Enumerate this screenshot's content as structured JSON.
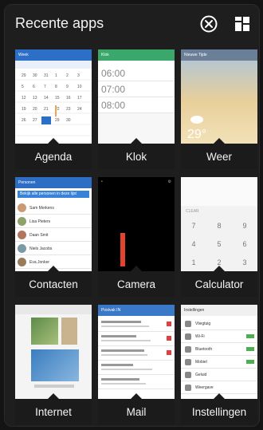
{
  "header": {
    "title": "Recente apps",
    "close_icon": "close-all-icon",
    "grid_icon": "grid-view-icon"
  },
  "colors": {
    "agenda": "#2c6fc6",
    "klok": "#3aa86a",
    "contacten": "#2d6ec4",
    "mail": "#3a78c8"
  },
  "apps": [
    {
      "label": "Agenda"
    },
    {
      "label": "Klok"
    },
    {
      "label": "Weer"
    },
    {
      "label": "Contacten"
    },
    {
      "label": "Camera"
    },
    {
      "label": "Calculator"
    },
    {
      "label": "Internet"
    },
    {
      "label": "Mail"
    },
    {
      "label": "Instellingen"
    }
  ],
  "thumbs": {
    "agenda_bar": "Week",
    "klok_bar": "Klok",
    "klok_times": [
      "06:00",
      "07:00",
      "08:00"
    ],
    "weer_bar": "Nieuwe Tijde",
    "weer_temp": "29°",
    "contacten_bar": "Personen",
    "contacten_banner": "Bekijk alle personen in deze lijst",
    "contacten_names": [
      "Sam Merkens",
      "Lisa Pieters",
      "Daan Smit",
      "Niels Jacobs",
      "Eva Jonker"
    ],
    "calc_clear": "CLEAR",
    "calc_keys": [
      "7",
      "8",
      "9",
      "4",
      "5",
      "6",
      "1",
      "2",
      "3"
    ],
    "mail_bar": "Postvak IN",
    "instel_bar": "Instellingen",
    "instel_items": [
      "Vliegtuig",
      "Wi-Fi",
      "Bluetooth",
      "Mobiel",
      "Geluid",
      "Weergave"
    ]
  }
}
